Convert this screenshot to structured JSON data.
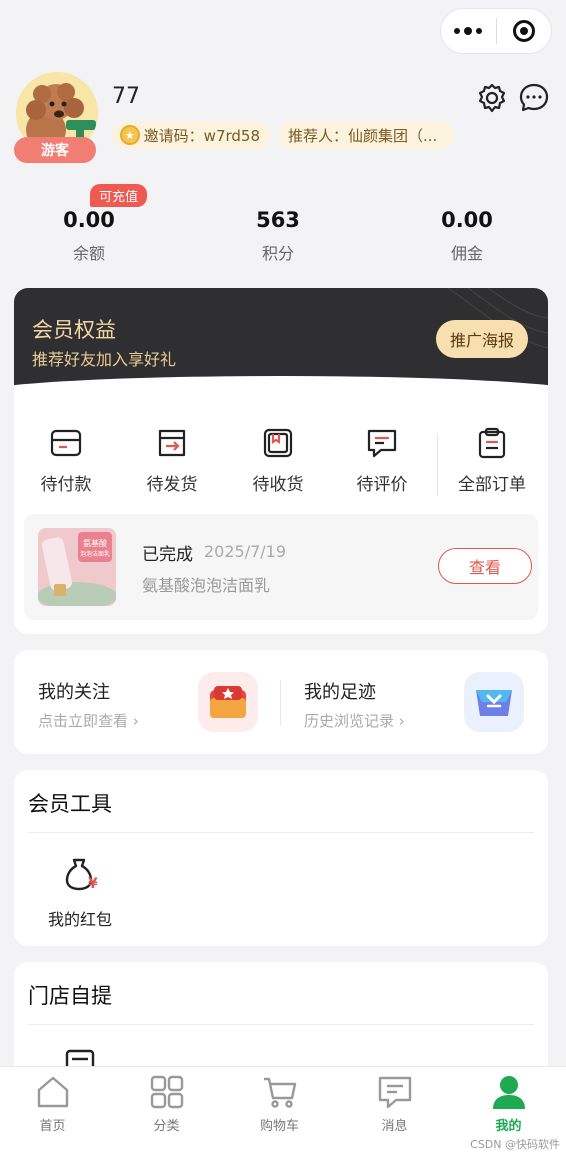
{
  "user": {
    "name": "77",
    "role_badge": "游客",
    "invite_code": "邀请码：w7rd58",
    "referrer": "推荐人：仙颜集团（..."
  },
  "stats": {
    "recharge_tag": "可充值",
    "items": [
      {
        "value": "0.00",
        "label": "余额"
      },
      {
        "value": "563",
        "label": "积分"
      },
      {
        "value": "0.00",
        "label": "佣金"
      }
    ]
  },
  "vip": {
    "title": "会员权益",
    "subtitle": "推荐好友加入享好礼",
    "button": "推广海报"
  },
  "orders": {
    "items": [
      {
        "label": "待付款",
        "icon": "wallet-card-icon"
      },
      {
        "label": "待发货",
        "icon": "box-arrow-icon"
      },
      {
        "label": "待收货",
        "icon": "package-icon"
      },
      {
        "label": "待评价",
        "icon": "comment-icon"
      },
      {
        "label": "全部订单",
        "icon": "clipboard-icon"
      }
    ],
    "recent": {
      "status": "已完成",
      "date": "2025/7/19",
      "product": "氨基酸泡泡洁面乳",
      "button": "查看",
      "thumb_text": "氨基酸\n泡泡洁面乳"
    }
  },
  "shortcuts": [
    {
      "title": "我的关注",
      "sub": "点击立即查看 ›",
      "icon": "star-box-icon"
    },
    {
      "title": "我的足迹",
      "sub": "历史浏览记录 ›",
      "icon": "footprint-box-icon"
    }
  ],
  "tools": {
    "title": "会员工具",
    "items": [
      {
        "label": "我的红包",
        "icon": "red-packet-icon"
      }
    ]
  },
  "store": {
    "title": "门店自提"
  },
  "tabbar": {
    "items": [
      {
        "label": "首页",
        "icon": "home-icon"
      },
      {
        "label": "分类",
        "icon": "grid-icon"
      },
      {
        "label": "购物车",
        "icon": "cart-icon"
      },
      {
        "label": "消息",
        "icon": "message-icon"
      },
      {
        "label": "我的",
        "icon": "user-icon",
        "active": true
      }
    ],
    "active_color": "#1faa52"
  },
  "watermark": "CSDN @快码软件",
  "colors": {
    "accent_red": "#e2574e",
    "vip_gold": "#f2d8a5",
    "vip_dark": "#2f2f31"
  }
}
